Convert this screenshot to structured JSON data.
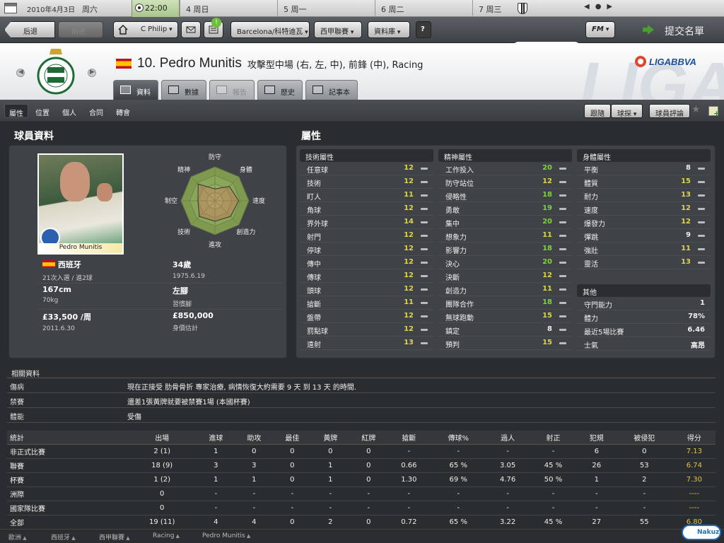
{
  "topbar": {
    "date": "2010年4月3日",
    "weekday": "周六",
    "time": "22:00",
    "schedule": [
      {
        "day": "4",
        "name": "周日"
      },
      {
        "day": "5",
        "name": "周一"
      },
      {
        "day": "6",
        "name": "周二"
      },
      {
        "day": "7",
        "name": "周三"
      }
    ]
  },
  "nav": {
    "back": "后退",
    "forward": "前进",
    "manager": "C Philip",
    "notifications_badge": "!",
    "club": "Barcelona/科特迪瓦",
    "competition": "西甲聯賽",
    "database": "資料庫",
    "help": "?",
    "search_placeholder": "",
    "fm_label": "FM",
    "submit": "提交名單"
  },
  "player": {
    "number_name": "10. Pedro Munitis",
    "description": "攻擊型中場 (右, 左, 中), 前鋒 (中), Racing",
    "photo_caption": "Pedro Munitis",
    "league_logo": "LIGABBVA"
  },
  "tabs": [
    {
      "label": "資料",
      "active": true,
      "icon": "profile-icon"
    },
    {
      "label": "數據",
      "active": false,
      "icon": "stats-icon"
    },
    {
      "label": "報告",
      "active": false,
      "disabled": true,
      "icon": "report-icon"
    },
    {
      "label": "歷史",
      "active": false,
      "icon": "history-icon"
    },
    {
      "label": "記事本",
      "active": false,
      "icon": "notebook-icon"
    }
  ],
  "subnav": {
    "items": [
      "屬性",
      "位置",
      "個人",
      "合同",
      "轉會"
    ],
    "right": {
      "follow": "跟隨",
      "scout": "球探",
      "comment": "球員評論"
    }
  },
  "sections": {
    "player_info": "球員資料",
    "attributes": "屬性"
  },
  "radar": {
    "labels": [
      "防守",
      "身體",
      "速度",
      "創造力",
      "進攻",
      "技術",
      "制空",
      "精神"
    ],
    "values": [
      0.35,
      0.6,
      0.7,
      0.65,
      0.6,
      0.65,
      0.5,
      0.7
    ]
  },
  "info": {
    "nationality": "西班牙",
    "caps": "21次入選 / 進2球",
    "age": "34歲",
    "dob": "1975.6.19",
    "height": "167cm",
    "weight": "70kg",
    "foot": "左腳",
    "foot_label": "習慣腳",
    "wage": "£33,500 /周",
    "contract_end": "2011.6.30",
    "value": "£850,000",
    "value_label": "身價估計"
  },
  "technical": {
    "title": "技術屬性",
    "rows": [
      {
        "name": "任意球",
        "value": 12,
        "color": "y"
      },
      {
        "name": "技術",
        "value": 12,
        "color": "y"
      },
      {
        "name": "盯人",
        "value": 11,
        "color": "y"
      },
      {
        "name": "角球",
        "value": 12,
        "color": "y"
      },
      {
        "name": "界外球",
        "value": 14,
        "color": "y"
      },
      {
        "name": "射門",
        "value": 12,
        "color": "y"
      },
      {
        "name": "停球",
        "value": 12,
        "color": "y"
      },
      {
        "name": "傳中",
        "value": 12,
        "color": "y"
      },
      {
        "name": "傳球",
        "value": 12,
        "color": "y"
      },
      {
        "name": "頭球",
        "value": 12,
        "color": "y"
      },
      {
        "name": "搶斷",
        "value": 11,
        "color": "y"
      },
      {
        "name": "盤帶",
        "value": 12,
        "color": "y"
      },
      {
        "name": "罰點球",
        "value": 12,
        "color": "y"
      },
      {
        "name": "遠射",
        "value": 13,
        "color": "y"
      }
    ]
  },
  "mental": {
    "title": "精神屬性",
    "rows": [
      {
        "name": "工作投入",
        "value": 20,
        "color": "g"
      },
      {
        "name": "防守站位",
        "value": 12,
        "color": "y"
      },
      {
        "name": "侵略性",
        "value": 18,
        "color": "g"
      },
      {
        "name": "勇敢",
        "value": 19,
        "color": "g"
      },
      {
        "name": "集中",
        "value": 20,
        "color": "g"
      },
      {
        "name": "想象力",
        "value": 11,
        "color": "y"
      },
      {
        "name": "影響力",
        "value": 18,
        "color": "g"
      },
      {
        "name": "決心",
        "value": 20,
        "color": "g"
      },
      {
        "name": "決斷",
        "value": 12,
        "color": "y"
      },
      {
        "name": "創造力",
        "value": 11,
        "color": "y"
      },
      {
        "name": "團隊合作",
        "value": 18,
        "color": "g"
      },
      {
        "name": "無球跑動",
        "value": 15,
        "color": "y"
      },
      {
        "name": "鎮定",
        "value": 8,
        "color": "w"
      },
      {
        "name": "預判",
        "value": 15,
        "color": "y"
      }
    ]
  },
  "physical": {
    "title": "身體屬性",
    "rows": [
      {
        "name": "平衡",
        "value": 8,
        "color": "w"
      },
      {
        "name": "體質",
        "value": 15,
        "color": "y"
      },
      {
        "name": "耐力",
        "value": 13,
        "color": "y"
      },
      {
        "name": "速度",
        "value": 12,
        "color": "y"
      },
      {
        "name": "爆發力",
        "value": 12,
        "color": "y"
      },
      {
        "name": "彈跳",
        "value": 9,
        "color": "w"
      },
      {
        "name": "強壯",
        "value": 11,
        "color": "y"
      },
      {
        "name": "靈活",
        "value": 13,
        "color": "y"
      }
    ]
  },
  "other": {
    "title": "其他",
    "rows": [
      {
        "name": "守門能力",
        "value": "1"
      },
      {
        "name": "體力",
        "value": "78%"
      },
      {
        "name": "最近5場比賽",
        "value": "6.46"
      },
      {
        "name": "士氣",
        "value": "高昂"
      }
    ]
  },
  "related": {
    "title": "相關資料",
    "rows": [
      {
        "key": "傷病",
        "value": "現在正接受 肋骨骨折 專家治療, 病情恢復大約需要 9 天 到 13 天 的時間."
      },
      {
        "key": "禁賽",
        "value": "還差1張黃牌就要被禁賽1場 (本國杯賽)"
      },
      {
        "key": "體能",
        "value": "受傷"
      }
    ]
  },
  "stats": {
    "headers": [
      "統計",
      "出場",
      "進球",
      "助攻",
      "最佳",
      "黃牌",
      "紅牌",
      "搶斷",
      "傳球%",
      "過人",
      "射正",
      "犯規",
      "被侵犯",
      "得分"
    ],
    "rows": [
      [
        "非正式比賽",
        "2 (1)",
        "1",
        "0",
        "0",
        "0",
        "0",
        "-",
        "-",
        "-",
        "-",
        "6",
        "0",
        "7.13"
      ],
      [
        "聯賽",
        "18 (9)",
        "3",
        "3",
        "0",
        "1",
        "0",
        "0.66",
        "65 %",
        "3.05",
        "45 %",
        "26",
        "53",
        "6.74"
      ],
      [
        "杯賽",
        "1 (2)",
        "1",
        "1",
        "0",
        "1",
        "0",
        "1.30",
        "69 %",
        "4.76",
        "50 %",
        "1",
        "2",
        "7.30"
      ],
      [
        "洲際",
        "0",
        "-",
        "-",
        "-",
        "-",
        "-",
        "-",
        "-",
        "-",
        "-",
        "-",
        "-",
        "----"
      ],
      [
        "國家隊比賽",
        "0",
        "-",
        "-",
        "-",
        "-",
        "-",
        "-",
        "-",
        "-",
        "-",
        "-",
        "-",
        "----"
      ],
      [
        "全部",
        "19 (11)",
        "4",
        "4",
        "0",
        "2",
        "0",
        "0.72",
        "65 %",
        "3.22",
        "45 %",
        "27",
        "55",
        "6.80"
      ]
    ]
  },
  "footer": [
    "歐洲",
    "西班牙",
    "西甲聯賽",
    "Racing",
    "Pedro Munitis"
  ],
  "watermark": "Nakuz"
}
